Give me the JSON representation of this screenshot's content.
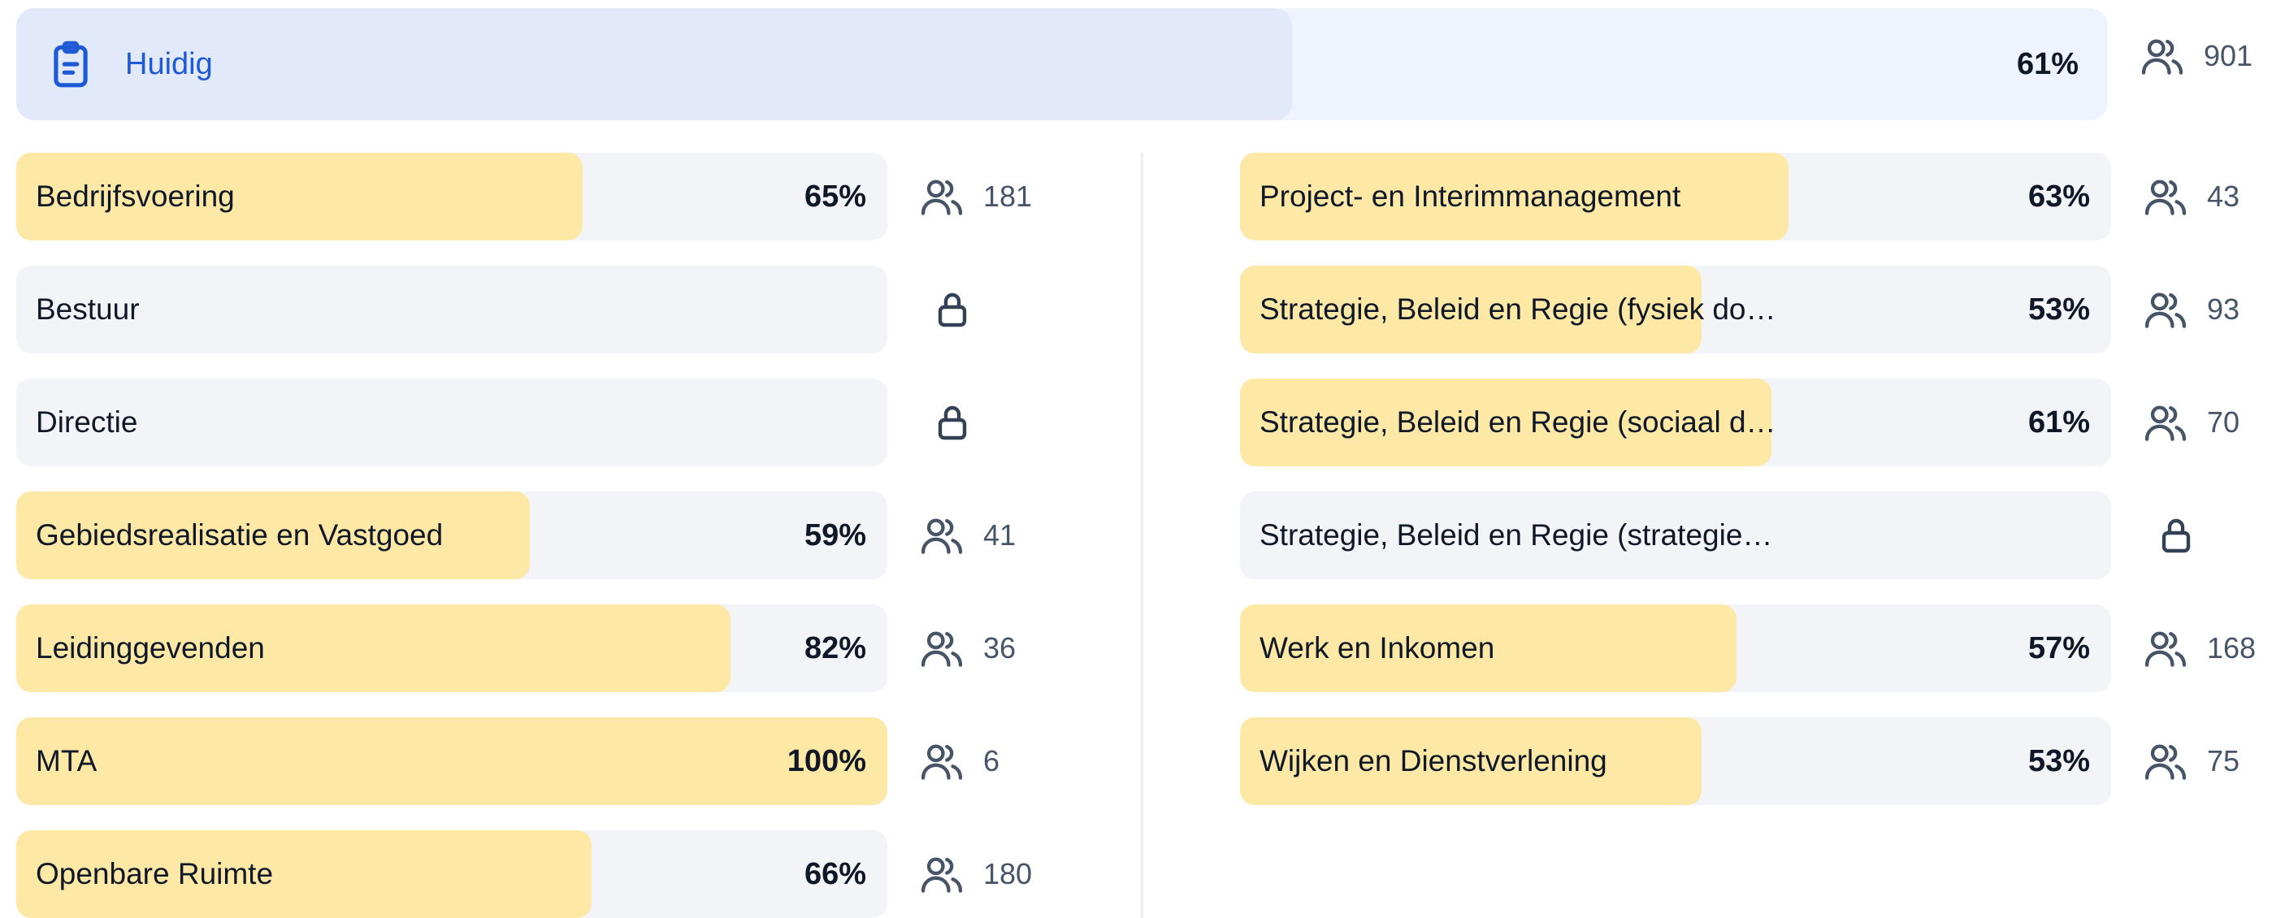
{
  "summary": {
    "label": "Huidig",
    "icon": "clipboard-icon",
    "value": 61,
    "percent_label": "61%",
    "respondents": "901",
    "colors": {
      "track": "#eef3fd",
      "fill": "#e1e9fb",
      "label": "#1e5ad6"
    }
  },
  "chart_data": {
    "type": "bar",
    "orientation": "horizontal",
    "unit": "%",
    "xlim": [
      0,
      100
    ],
    "bar_color": "#fde8a6",
    "track_color": "#f3f4f8",
    "left_column": [
      {
        "category": "Bedrijfsvoering",
        "value": 65,
        "label": "65%",
        "count": "181",
        "locked": false
      },
      {
        "category": "Bestuur",
        "value": null,
        "label": "",
        "count": "",
        "locked": true
      },
      {
        "category": "Directie",
        "value": null,
        "label": "",
        "count": "",
        "locked": true
      },
      {
        "category": "Gebiedsrealisatie en Vastgoed",
        "value": 59,
        "label": "59%",
        "count": "41",
        "locked": false
      },
      {
        "category": "Leidinggevenden",
        "value": 82,
        "label": "82%",
        "count": "36",
        "locked": false
      },
      {
        "category": "MTA",
        "value": 100,
        "label": "100%",
        "count": "6",
        "locked": false
      },
      {
        "category": "Openbare Ruimte",
        "value": 66,
        "label": "66%",
        "count": "180",
        "locked": false
      }
    ],
    "right_column": [
      {
        "category": "Project- en Interimmanagement",
        "value": 63,
        "label": "63%",
        "count": "43",
        "locked": false
      },
      {
        "category": "Strategie, Beleid en Regie (fysiek do…",
        "value": 53,
        "label": "53%",
        "count": "93",
        "locked": false
      },
      {
        "category": "Strategie, Beleid en Regie (sociaal d…",
        "value": 61,
        "label": "61%",
        "count": "70",
        "locked": false
      },
      {
        "category": "Strategie, Beleid en Regie (strategie…",
        "value": null,
        "label": "",
        "count": "",
        "locked": true
      },
      {
        "category": "Werk en Inkomen",
        "value": 57,
        "label": "57%",
        "count": "168",
        "locked": false
      },
      {
        "category": "Wijken en Dienstverlening",
        "value": 53,
        "label": "53%",
        "count": "75",
        "locked": false
      }
    ]
  }
}
